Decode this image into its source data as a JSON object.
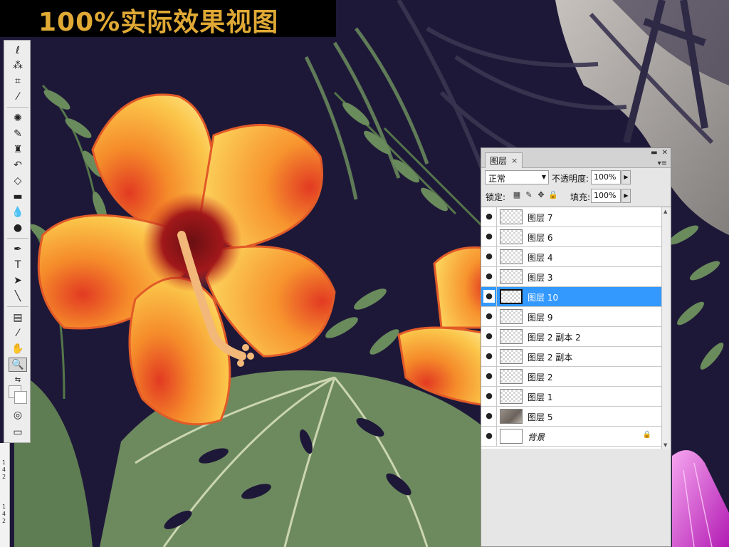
{
  "banner": {
    "title": "100%实际效果视图"
  },
  "tools": [
    {
      "name": "lasso-tool-icon",
      "glyph": "ℓ"
    },
    {
      "name": "magic-wand-tool-icon",
      "glyph": "⁂"
    },
    {
      "name": "crop-tool-icon",
      "glyph": "⌗"
    },
    {
      "name": "eyedropper-tool-icon",
      "glyph": "⁄"
    },
    {
      "name": "healing-brush-tool-icon",
      "glyph": "✺"
    },
    {
      "name": "brush-tool-icon",
      "glyph": "✎"
    },
    {
      "name": "clone-stamp-tool-icon",
      "glyph": "♜"
    },
    {
      "name": "history-brush-tool-icon",
      "glyph": "↶"
    },
    {
      "name": "eraser-tool-icon",
      "glyph": "◇"
    },
    {
      "name": "gradient-tool-icon",
      "glyph": "▬"
    },
    {
      "name": "blur-tool-icon",
      "glyph": "💧"
    },
    {
      "name": "dodge-tool-icon",
      "glyph": "●"
    },
    {
      "name": "pen-tool-icon",
      "glyph": "✒"
    },
    {
      "name": "type-tool-icon",
      "glyph": "T"
    },
    {
      "name": "path-selection-tool-icon",
      "glyph": "➤"
    },
    {
      "name": "line-tool-icon",
      "glyph": "╲"
    },
    {
      "name": "notes-tool-icon",
      "glyph": "▤"
    },
    {
      "name": "color-sampler-tool-icon",
      "glyph": "⁄"
    },
    {
      "name": "hand-tool-icon",
      "glyph": "✋"
    },
    {
      "name": "zoom-tool-icon",
      "glyph": "🔍"
    }
  ],
  "ruler": {
    "labels": [
      "1",
      "4",
      "2",
      "1",
      "4",
      "2"
    ]
  },
  "panel": {
    "tab_label": "图层",
    "close_glyph": "×",
    "blend_mode": "正常",
    "opacity_label": "不透明度:",
    "opacity_value": "100%",
    "lock_label": "锁定:",
    "fill_label": "填充:",
    "fill_value": "100%",
    "layers": [
      {
        "name": "图层 7",
        "thumb": "checker",
        "active": false
      },
      {
        "name": "图层 6",
        "thumb": "checker",
        "active": false
      },
      {
        "name": "图层 4",
        "thumb": "checker",
        "active": false
      },
      {
        "name": "图层 3",
        "thumb": "checker",
        "active": false
      },
      {
        "name": "图层 10",
        "thumb": "checker",
        "active": true
      },
      {
        "name": "图层 9",
        "thumb": "checker",
        "active": false
      },
      {
        "name": "图层 2 副本 2",
        "thumb": "checker",
        "active": false
      },
      {
        "name": "图层 2 副本",
        "thumb": "checker",
        "active": false
      },
      {
        "name": "图层 2",
        "thumb": "checker",
        "active": false
      },
      {
        "name": "图层 1",
        "thumb": "checker",
        "active": false
      },
      {
        "name": "图层 5",
        "thumb": "texture",
        "active": false
      },
      {
        "name": "背景",
        "thumb": "white",
        "active": false,
        "locked": true
      }
    ]
  },
  "colors": {
    "canvas_bg": "#1e1838",
    "banner_text": "#e0a935",
    "selection": "#3399ff"
  }
}
